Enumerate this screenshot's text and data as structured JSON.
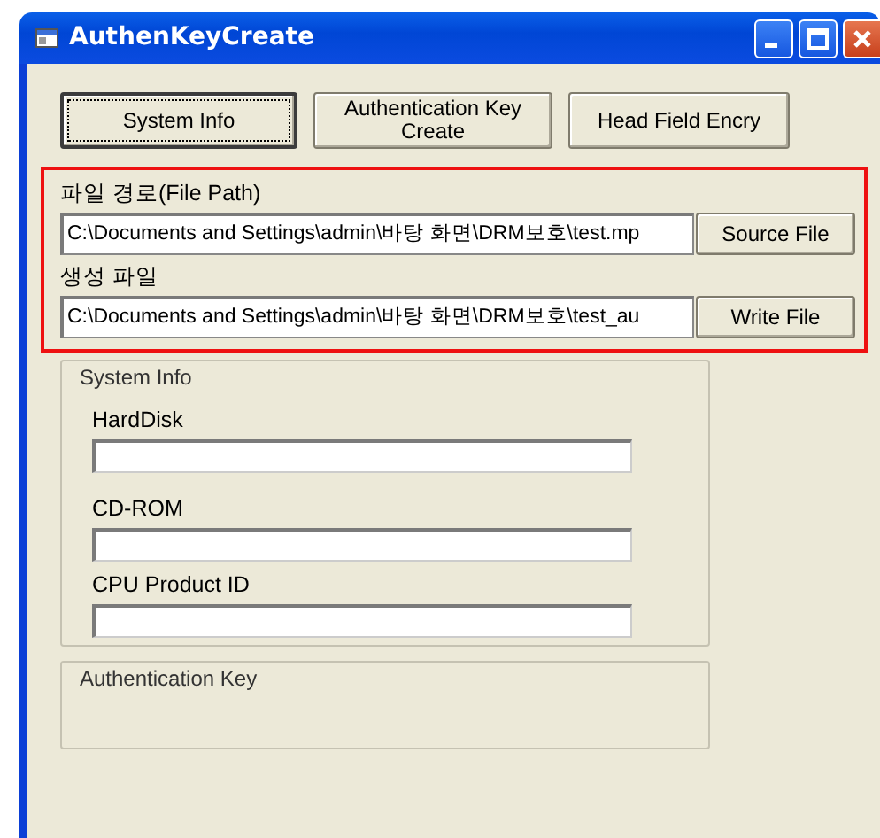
{
  "window": {
    "title": "AuthenKeyCreate"
  },
  "buttons": [
    {
      "label": "System Info",
      "focused": true
    },
    {
      "label": "Authentication Key Create",
      "focused": false
    },
    {
      "label": "Head Field Encry",
      "focused": false
    }
  ],
  "file_fields": [
    {
      "label": "파일 경로(File Path)",
      "value": "C:\\Documents and Settings\\admin\\바탕 화면\\DRM보호\\test.mp",
      "button": "Source File"
    },
    {
      "label": "생성 파일",
      "value": "C:\\Documents and Settings\\admin\\바탕 화면\\DRM보호\\test_au",
      "button": "Write File"
    }
  ],
  "system_info": {
    "title": "System Info",
    "fields": [
      {
        "label": "HardDisk"
      },
      {
        "label": "CD-ROM"
      },
      {
        "label": "CPU Product ID"
      }
    ]
  },
  "auth_key": {
    "title": "Authentication Key"
  }
}
